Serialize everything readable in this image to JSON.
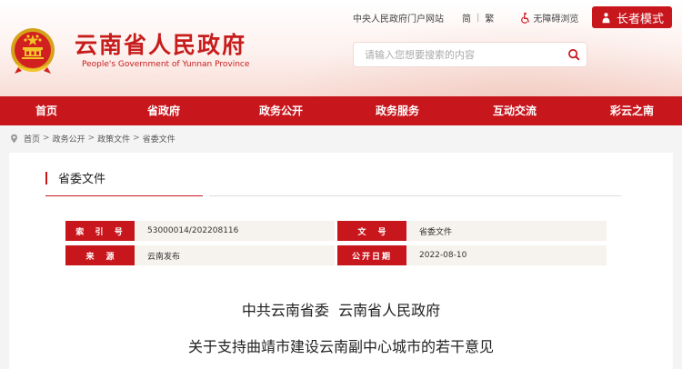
{
  "header": {
    "site_title": "云南省人民政府",
    "site_subtitle": "People's Government of Yunnan Province",
    "top_links": {
      "portal": "中央人民政府门户网站",
      "simplified": "简",
      "traditional": "繁",
      "accessibility": "无障碍浏览"
    },
    "elder_mode": "长者模式",
    "search": {
      "placeholder": "请输入您想要搜索的内容"
    }
  },
  "nav": {
    "items": [
      "首页",
      "省政府",
      "政务公开",
      "政务服务",
      "互动交流",
      "彩云之南"
    ]
  },
  "breadcrumb": [
    "首页",
    "政务公开",
    "政策文件",
    "省委文件"
  ],
  "section": {
    "title": "省委文件"
  },
  "meta": {
    "index_label": "索  引  号",
    "index_value": "53000014/202208116",
    "docno_label": "文号",
    "docno_value": "省委文件",
    "source_label": "来源",
    "source_value": "云南发布",
    "date_label": "公开日期",
    "date_value": "2022-08-10"
  },
  "document": {
    "title_line1": "中共云南省委  云南省人民政府",
    "title_line2": "关于支持曲靖市建设云南副中心城市的若干意见"
  },
  "colors": {
    "brand_red": "#c8161d",
    "meta_bg": "#f6f3ee"
  }
}
